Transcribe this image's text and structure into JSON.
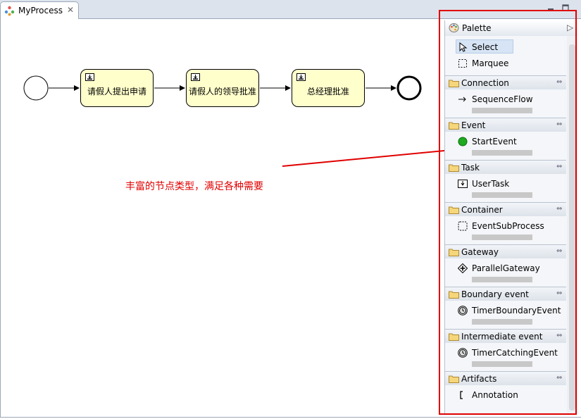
{
  "editor": {
    "tab_label": "MyProcess"
  },
  "diagram": {
    "tasks": [
      {
        "label": "请假人提出申请"
      },
      {
        "label": "请假人的领导批准"
      },
      {
        "label": "总经理批准"
      }
    ]
  },
  "annotation": {
    "text": "丰富的节点类型，满足各种需要"
  },
  "palette": {
    "title": "Palette",
    "tools": {
      "select": "Select",
      "marquee": "Marquee"
    },
    "drawers": [
      {
        "name": "Connection",
        "item": "SequenceFlow"
      },
      {
        "name": "Event",
        "item": "StartEvent"
      },
      {
        "name": "Task",
        "item": "UserTask"
      },
      {
        "name": "Container",
        "item": "EventSubProcess"
      },
      {
        "name": "Gateway",
        "item": "ParallelGateway"
      },
      {
        "name": "Boundary event",
        "item": "TimerBoundaryEvent"
      },
      {
        "name": "Intermediate event",
        "item": "TimerCatchingEvent"
      },
      {
        "name": "Artifacts",
        "item": "Annotation"
      }
    ]
  },
  "colors": {
    "highlight": "#e00000",
    "task_fill": "#ffffcc",
    "start_event": "#1faa1f"
  }
}
